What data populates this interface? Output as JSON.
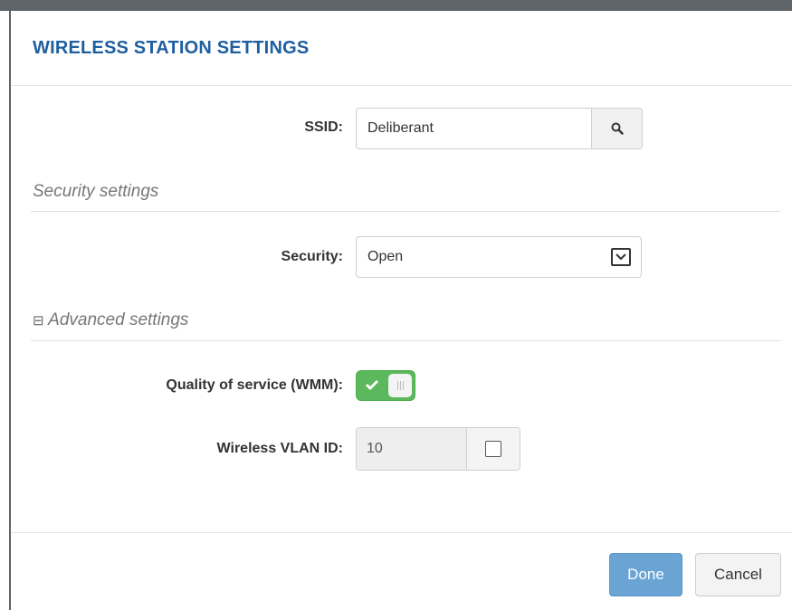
{
  "dialog": {
    "title": "WIRELESS STATION SETTINGS"
  },
  "ssid": {
    "label": "SSID:",
    "value": "Deliberant",
    "search_icon": "search-icon"
  },
  "security_section": {
    "heading": "Security settings",
    "security_label": "Security:",
    "security_value": "Open"
  },
  "advanced_section": {
    "toggle_symbol": "⊟",
    "heading": "Advanced settings",
    "qos_label": "Quality of service (WMM):",
    "qos_enabled": true,
    "vlan_label": "Wireless VLAN ID:",
    "vlan_value": "10",
    "vlan_checked": false
  },
  "footer": {
    "done_label": "Done",
    "cancel_label": "Cancel"
  },
  "colors": {
    "title": "#1f5fa0",
    "toggle_on": "#5cb85c",
    "primary_button": "#6aa4d4"
  }
}
